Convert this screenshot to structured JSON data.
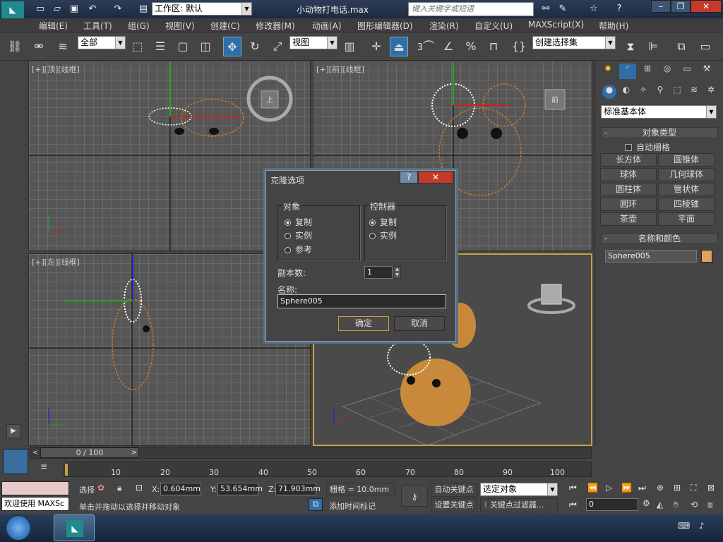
{
  "title_bar": {
    "workspace_label": "工作区: 默认",
    "file_title": "小动物打电话.max",
    "search_placeholder": "键入关键字或短语"
  },
  "menu": [
    "编辑(E)",
    "工具(T)",
    "组(G)",
    "视图(V)",
    "创建(C)",
    "修改器(M)",
    "动画(A)",
    "图形编辑器(D)",
    "渲染(R)",
    "自定义(U)",
    "MAXScript(X)",
    "帮助(H)"
  ],
  "toolbar": {
    "selection_filter": "全部",
    "ref_coord": "视图",
    "named_selection": "创建选择集",
    "snap_number": "3"
  },
  "viewports": {
    "top": "[+][顶][线框]",
    "front": "[+][前][线框]",
    "left": "[+][左][线框]",
    "front_cube_label": "前",
    "top_cube_label": "上"
  },
  "command_panel": {
    "category": "标准基本体",
    "object_type_header": "对象类型",
    "autogrid": "自动栅格",
    "buttons": [
      "长方体",
      "圆锥体",
      "球体",
      "几何球体",
      "圆柱体",
      "管状体",
      "圆环",
      "四棱锥",
      "茶壶",
      "平面"
    ],
    "name_color_header": "名称和颜色",
    "object_name": "Sphere005",
    "object_color": "#e0a060"
  },
  "dialog": {
    "title": "克隆选项",
    "object_group": "对象",
    "object_options": [
      "复制",
      "实例",
      "参考"
    ],
    "controller_group": "控制器",
    "controller_options": [
      "复制",
      "实例"
    ],
    "copies_label": "副本数:",
    "copies_value": "1",
    "name_label": "名称:",
    "name_value": "Sphere005",
    "ok": "确定",
    "cancel": "取消",
    "help": "?",
    "close": "✕"
  },
  "timeline": {
    "slider": "0 / 100",
    "ticks": [
      "10",
      "20",
      "30",
      "40",
      "50",
      "60",
      "70",
      "80",
      "90",
      "100"
    ]
  },
  "status": {
    "maxscript": "欢迎使用  MAXSc",
    "select_label": "选择",
    "x": "0.604mm",
    "y": "53.654mm",
    "z": "71.903mm",
    "grid": "栅格 = 10.0mm",
    "prompt": "单击并拖动以选择并移动对象",
    "add_time_tag": "添加时间标记",
    "auto_key": "自动关键点",
    "selected_object": "选定对象",
    "set_key": "设置关键点",
    "key_filter": "关键点过滤器...",
    "frame": "0"
  },
  "colors": {
    "accent_orange": "#c87a2a",
    "selected_white": "#ffffff",
    "viewport_bg": "#565656"
  }
}
